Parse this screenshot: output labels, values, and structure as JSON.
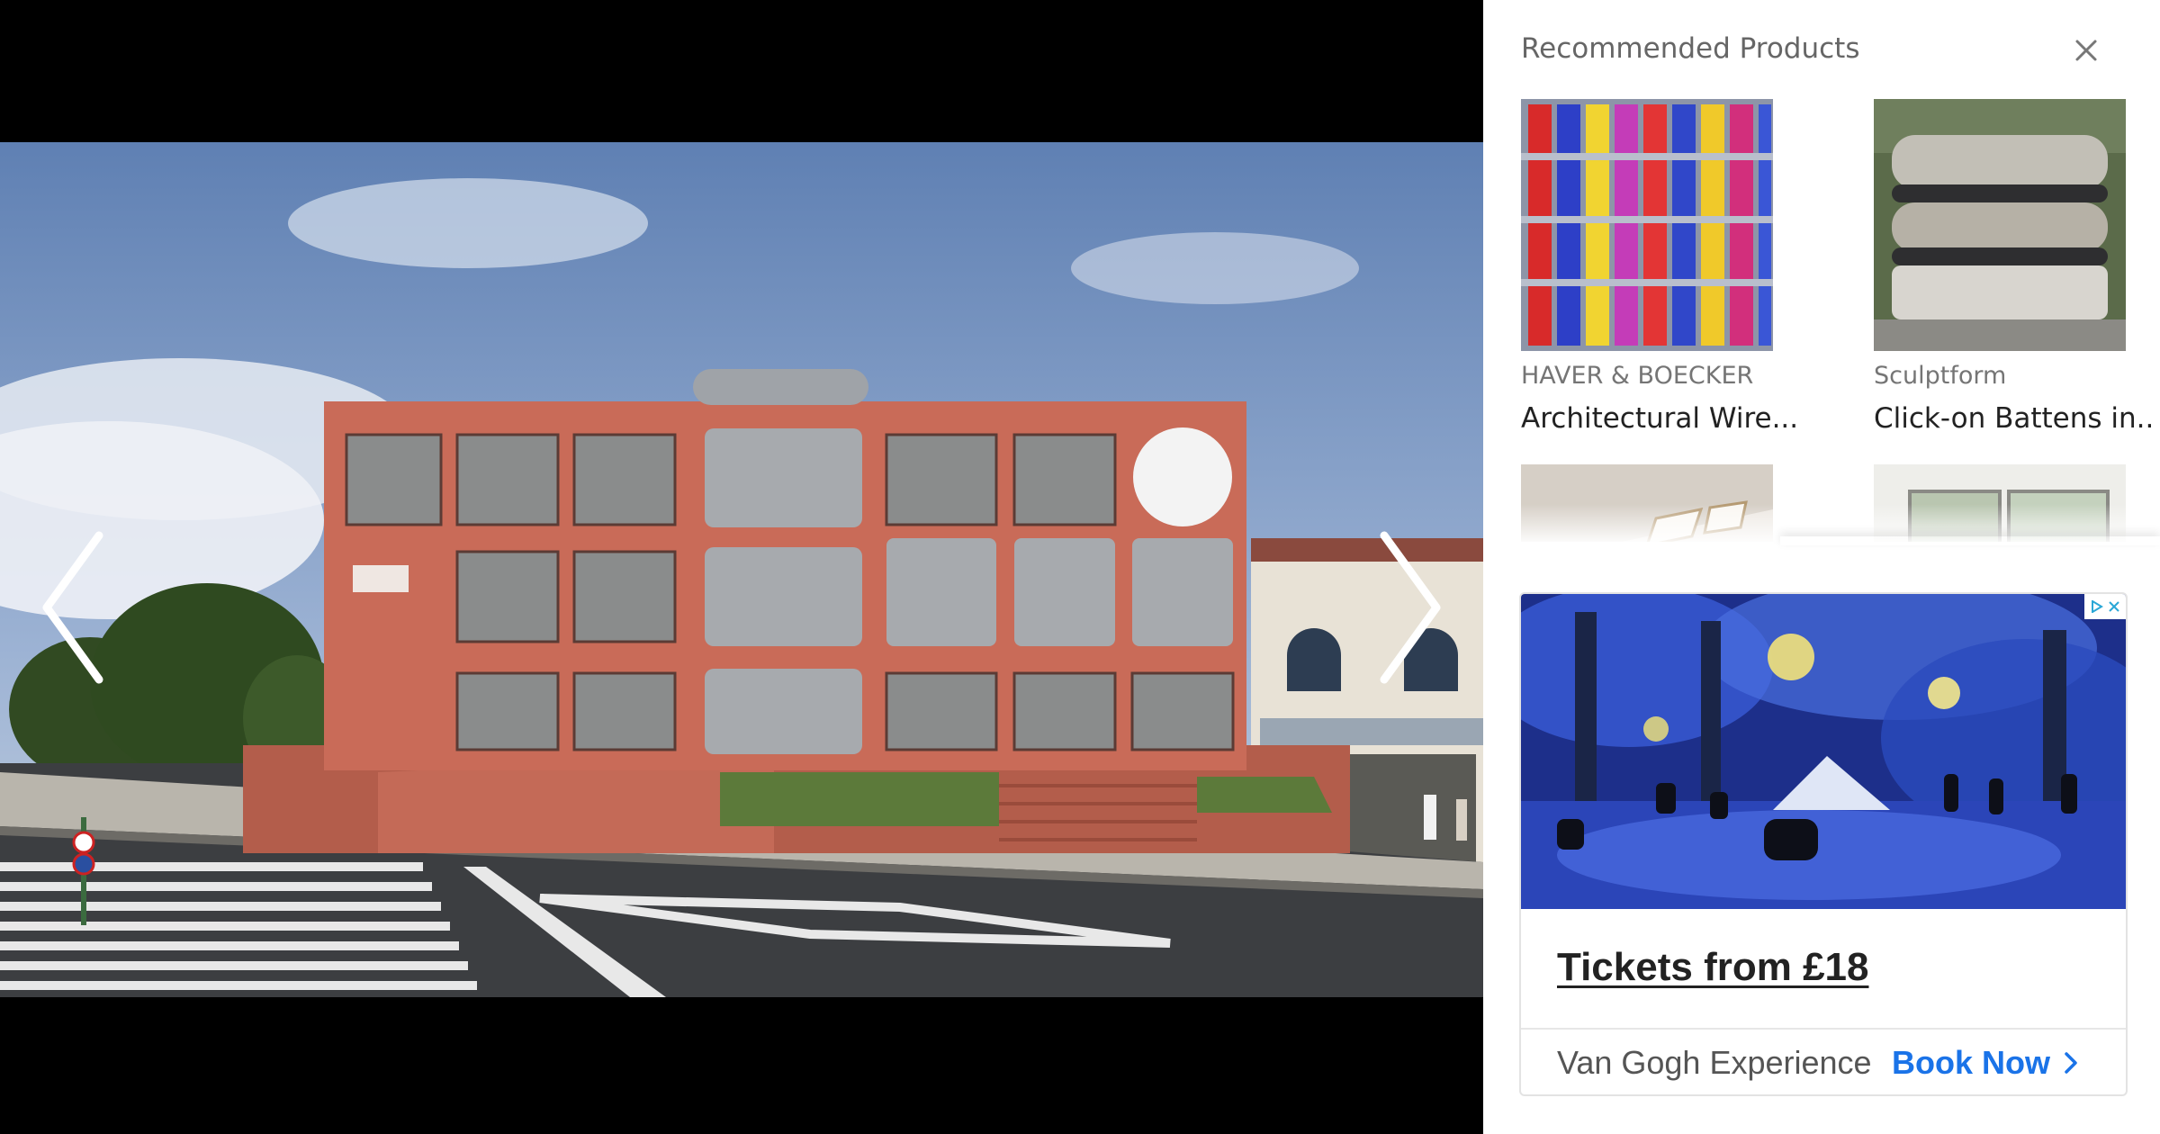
{
  "gallery": {
    "prev_icon": "chevron-left-icon",
    "next_icon": "chevron-right-icon",
    "colors": {
      "facade": "#c96b58",
      "sky": "#7e9cc7",
      "road": "#3b3d40"
    }
  },
  "sidebar": {
    "title": "Recommended Products",
    "close_icon": "close-icon",
    "products": [
      {
        "brand": "HAVER & BOECKER",
        "name": "Architectural Wire..."
      },
      {
        "brand": "Sculptform",
        "name": "Click-on Battens in..."
      },
      {
        "brand": "",
        "name": ""
      },
      {
        "brand": "",
        "name": ""
      }
    ]
  },
  "ad": {
    "headline": "Tickets from £18",
    "advertiser": "Van Gogh Experience",
    "cta": "Book Now",
    "adchoices_icons": [
      "play-icon",
      "close-icon"
    ],
    "colors": {
      "cta": "#1a73e8"
    }
  }
}
